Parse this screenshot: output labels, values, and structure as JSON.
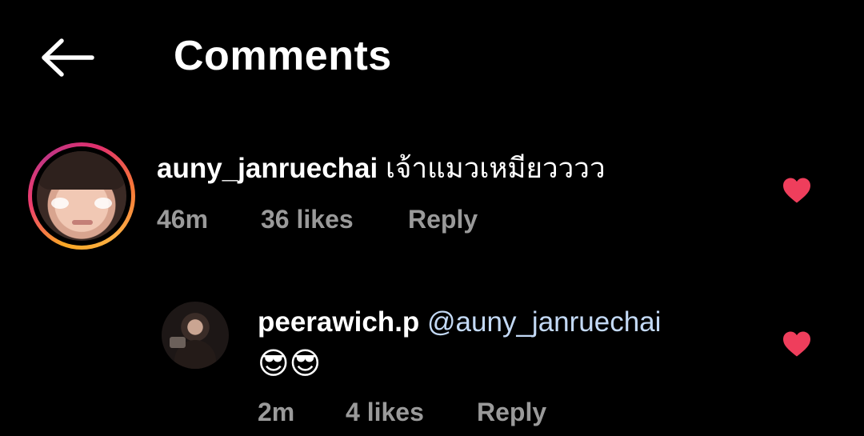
{
  "header": {
    "title": "Comments",
    "back_icon": "arrow-left-icon"
  },
  "comments": [
    {
      "username": "auny_janruechai",
      "text": "เจ้าแมวเหมียวววว",
      "time": "46m",
      "likes": "36 likes",
      "reply_label": "Reply",
      "liked": true,
      "has_story_ring": true
    },
    {
      "username": "peerawich.p",
      "mention": "@auny_janruechai",
      "emoji": "😎😎",
      "time": "2m",
      "likes": "4 likes",
      "reply_label": "Reply",
      "liked": true
    }
  ],
  "colors": {
    "background": "#000000",
    "heart": "#ef3e5c",
    "meta": "#9a9a9a",
    "mention": "#c3d9f5"
  }
}
